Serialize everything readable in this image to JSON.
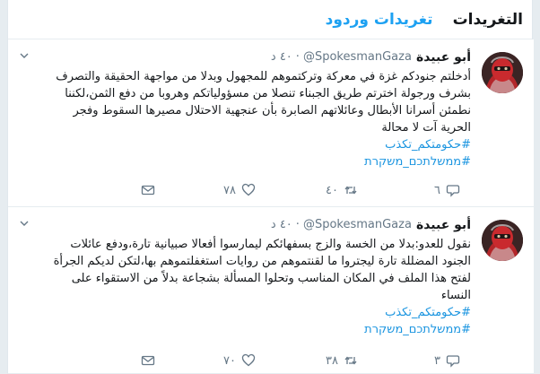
{
  "tabs": [
    {
      "label": "التغريدات",
      "active": true
    },
    {
      "label": "تغريدات وردود",
      "active": false
    }
  ],
  "tweets": [
    {
      "author": "أبو عبيدة",
      "handle": "@SpokesmanGaza",
      "time": "٤٠ د",
      "lines": [
        "أدخلتم جنودكم غزة في معركة وتركتموهم للمجهول وبدلا من مواجهة الحقيقة والتصرف",
        "بشرف ورجولة اخترتم طريق الجبناء تنصلا من مسؤولياتكم وهروبا من دفع الثمن،لكننا",
        "نطمئن أسرانا الأبطال وعائلاتهم الصابرة بأن عنجهية الاحتلال مصيرها السقوط وفجر",
        "الحرية آت لا محالة"
      ],
      "hashtags": [
        "#حكومتكم_تكذب",
        "#ממשלתכם_משקרת"
      ],
      "replies": "٦",
      "retweets": "٤٠",
      "likes": "٧٨"
    },
    {
      "author": "أبو عبيدة",
      "handle": "@SpokesmanGaza",
      "time": "٤٠ د",
      "lines": [
        "نقول للعدو:بدلا من الخسة والزج بسفهائكم ليمارسوا أفعالا صبيانية تارة،ودفع عائلات",
        "الجنود المضللة تارة ليجتروا ما لقنتموهم من روايات استغفلتموهم بها،لتكن لديكم الجرأة",
        "لفتح هذا الملف في المكان المناسب وتحلوا المسألة بشجاعة بدلاً من الاستقواء على",
        "النساء"
      ],
      "hashtags": [
        "#حكومتكم_تكذب",
        "#ממשלתכם_משקרת"
      ],
      "replies": "٣",
      "retweets": "٣٨",
      "likes": "٧٠"
    }
  ]
}
